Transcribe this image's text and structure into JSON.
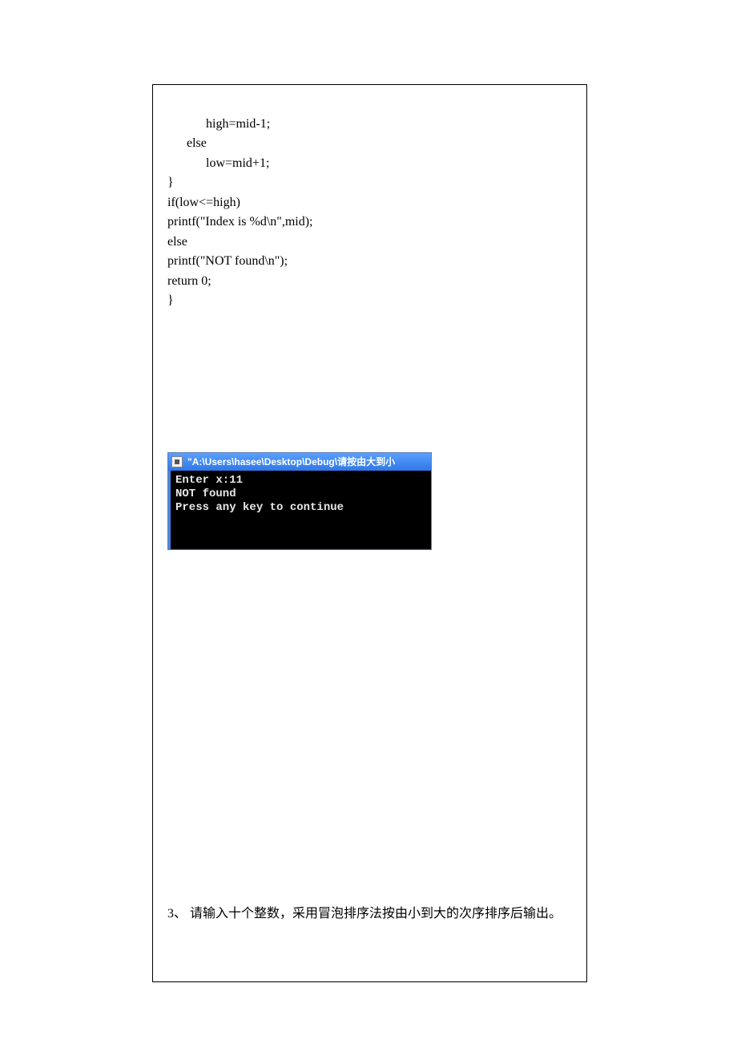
{
  "code": {
    "line1": "            high=mid-1;",
    "line2": "      else",
    "line3": "            low=mid+1;",
    "line4": "}",
    "line5": "if(low<=high)",
    "line6": "printf(\"Index is %d\\n\",mid);",
    "line7": "else",
    "line8": "printf(\"NOT found\\n\");",
    "line9": "return 0;",
    "line10": "}"
  },
  "console": {
    "title": "\"A:\\Users\\hasee\\Desktop\\Debug\\请按由大到小",
    "line1": "Enter x:11",
    "line2": "NOT found",
    "line3": "Press any key to continue"
  },
  "question": {
    "label": "3、 请输入十个整数，采用冒泡排序法按由小到大的次序排序后输出。"
  }
}
